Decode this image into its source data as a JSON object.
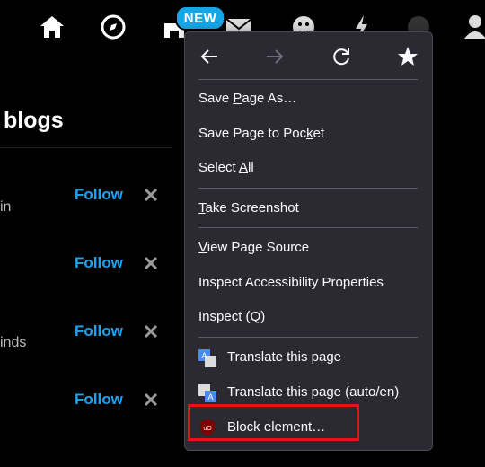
{
  "page": {
    "heading": "blogs",
    "rows": [
      {
        "text": "in",
        "follow": "Follow"
      },
      {
        "text": "",
        "follow": "Follow"
      },
      {
        "text": "inds",
        "follow": "Follow"
      },
      {
        "text": "",
        "follow": "Follow"
      }
    ]
  },
  "topbar": {
    "badge": "NEW",
    "icons": [
      "home-icon",
      "compass-icon",
      "store-icon",
      "mail-icon",
      "emoji-icon",
      "lightning-icon",
      "account-icon",
      "user-icon"
    ]
  },
  "menu": {
    "nav": [
      "back-icon",
      "forward-icon",
      "reload-icon",
      "bookmark-star-icon"
    ],
    "items": {
      "save_as_pre": "Save ",
      "save_as_u": "P",
      "save_as_post": "age As…",
      "save_pocket_pre": "Save Page to Poc",
      "save_pocket_u": "k",
      "save_pocket_post": "et",
      "select_all_pre": "Select ",
      "select_all_u": "A",
      "select_all_post": "ll",
      "screenshot_u": "T",
      "screenshot_post": "ake Screenshot",
      "view_source_u": "V",
      "view_source_post": "iew Page Source",
      "inspect_a11y": "Inspect Accessibility Properties",
      "inspect": "Inspect (Q)",
      "translate": "Translate this page",
      "translate_auto": "Translate this page (auto/en)",
      "block_element": "Block element…"
    }
  },
  "colors": {
    "follow": "#1ea4f0",
    "badge": "#16a6e6",
    "menu_bg": "#2b2a33",
    "highlight": "#e5141b"
  }
}
